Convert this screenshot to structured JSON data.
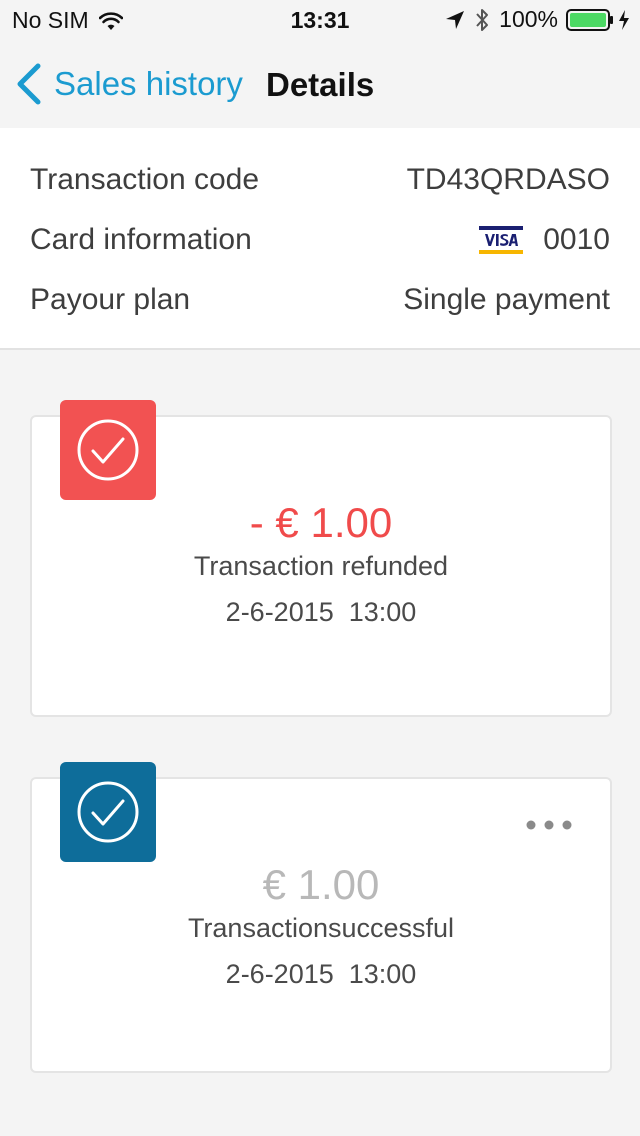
{
  "status_bar": {
    "carrier": "No SIM",
    "time": "13:31",
    "battery": "100%"
  },
  "nav": {
    "back_label": "Sales history",
    "title": "Details",
    "back_color": "#1b9bd0"
  },
  "details": {
    "rows": [
      {
        "label": "Transaction code",
        "value": "TD43QRDASO"
      },
      {
        "label": "Card information",
        "value": "0010",
        "icon": "visa-icon"
      },
      {
        "label": "Payour plan",
        "value": "Single payment"
      }
    ]
  },
  "transactions": [
    {
      "amount": "- € 1.00",
      "status": "Transaction refunded",
      "date": "2-6-2015  13:00",
      "badge_color": "#f25252",
      "icon": "check-icon"
    },
    {
      "amount": "€ 1.00",
      "status": "Transactionsuccessful",
      "date": "2-6-2015  13:00",
      "badge_color": "#0e6d9a",
      "icon": "check-icon",
      "menu_icon": "more-icon"
    }
  ]
}
